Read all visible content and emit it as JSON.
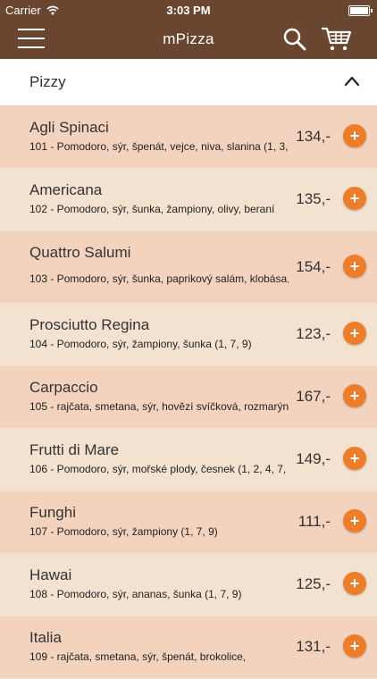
{
  "status": {
    "carrier": "Carrier",
    "time": "3:03 PM"
  },
  "nav": {
    "title": "mPizza"
  },
  "section": {
    "title": "Pizzy"
  },
  "items": [
    {
      "name": "Agli Spinaci",
      "desc": "101 - Pomodoro, sýr, špenát, vejce, niva, slanina (1, 3,",
      "price": "134,-"
    },
    {
      "name": "Americana",
      "desc": "102 - Pomodoro, sýr, šunka, žampiony, olivy, beraní",
      "price": "135,-"
    },
    {
      "name": "Quattro Salumi",
      "desc": "103 - Pomodoro, sýr, šunka, paprikový salám, klobása,",
      "price": "154,-"
    },
    {
      "name": "Prosciutto Regina",
      "desc": "104 - Pomodoro, sýr, žampiony, šunka (1, 7, 9)",
      "price": "123,-"
    },
    {
      "name": "Carpaccio",
      "desc": "105 - rajčata, smetana, sýr, hovězí svíčková, rozmarýn",
      "price": "167,-"
    },
    {
      "name": "Frutti di Mare",
      "desc": "106 - Pomodoro, sýr, mořské plody, česnek (1, 2, 4, 7,",
      "price": "149,-"
    },
    {
      "name": "Funghi",
      "desc": "107 - Pomodoro, sýr, žampiony (1, 7, 9)",
      "price": "111,-"
    },
    {
      "name": "Hawai",
      "desc": "108 - Pomodoro, sýr, ananas, šunka (1, 7, 9)",
      "price": "125,-"
    },
    {
      "name": "Italia",
      "desc": "109 - rajčata, smetana, sýr, špenát, brokolice,",
      "price": "131,-"
    }
  ],
  "add_symbol": "+",
  "colors": {
    "header_bg": "#6a4630",
    "accent": "#ee7d2a",
    "row_odd": "#f3d3bd",
    "row_even": "#f4e2d0"
  },
  "icons": [
    "wifi-icon",
    "battery-icon",
    "menu-icon",
    "search-icon",
    "cart-icon",
    "chevron-up-icon",
    "plus-icon"
  ]
}
